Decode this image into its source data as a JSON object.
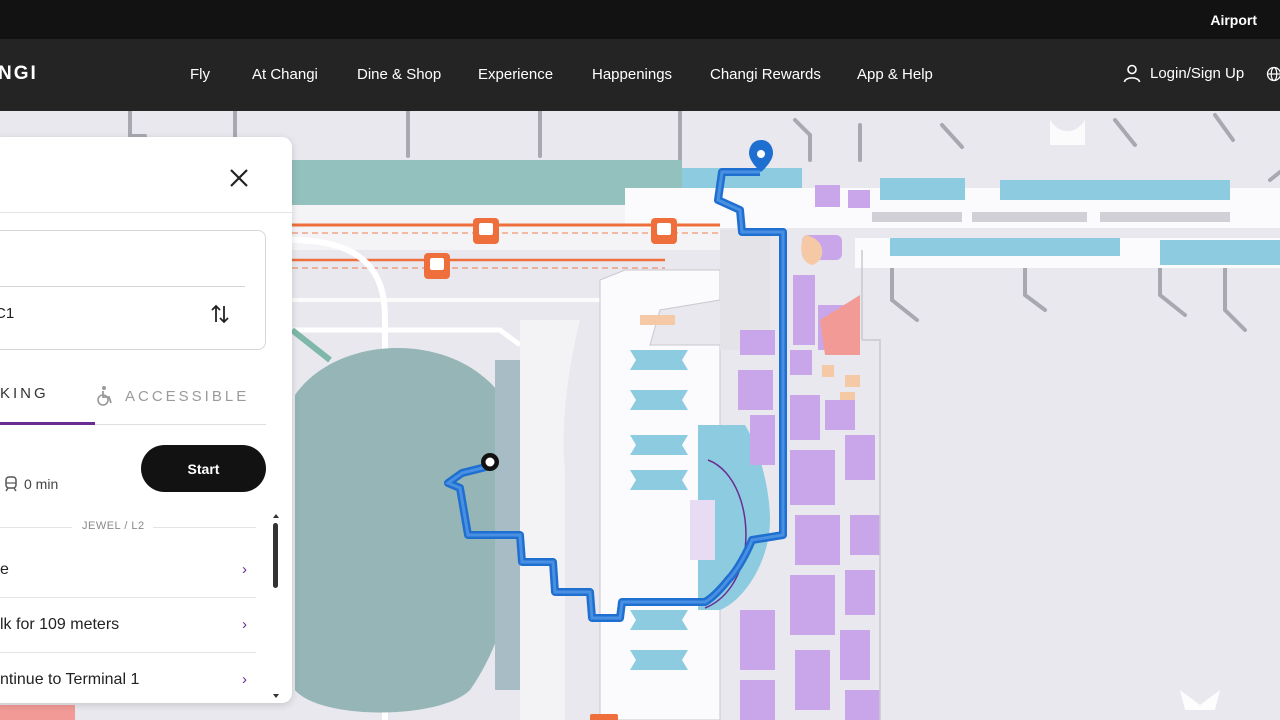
{
  "topbar": {
    "airport_label": "Airport"
  },
  "navbar": {
    "logo": "NGI",
    "items": [
      {
        "label": "Fly"
      },
      {
        "label": "At Changi"
      },
      {
        "label": "Dine & Shop"
      },
      {
        "label": "Experience"
      },
      {
        "label": "Happenings"
      },
      {
        "label": "Changi Rewards"
      },
      {
        "label": "App & Help"
      }
    ],
    "login_label": "Login/Sign Up"
  },
  "panel": {
    "destination_value": "C1",
    "tabs": {
      "walking": "KING",
      "accessible": "ACCESSIBLE"
    },
    "duration": "0 min",
    "start_label": "Start",
    "section_label": "JEWEL / L2",
    "steps": [
      {
        "text": "e"
      },
      {
        "text": "lk for 109 meters"
      },
      {
        "text": "ntinue to Terminal 1"
      }
    ]
  },
  "colors": {
    "route": "#1f6fd1",
    "accent_purple": "#6b2c91",
    "shop_purple": "#c9a6ea",
    "gate_blue": "#8dcbe0",
    "train_orange": "#ee6e3c"
  }
}
